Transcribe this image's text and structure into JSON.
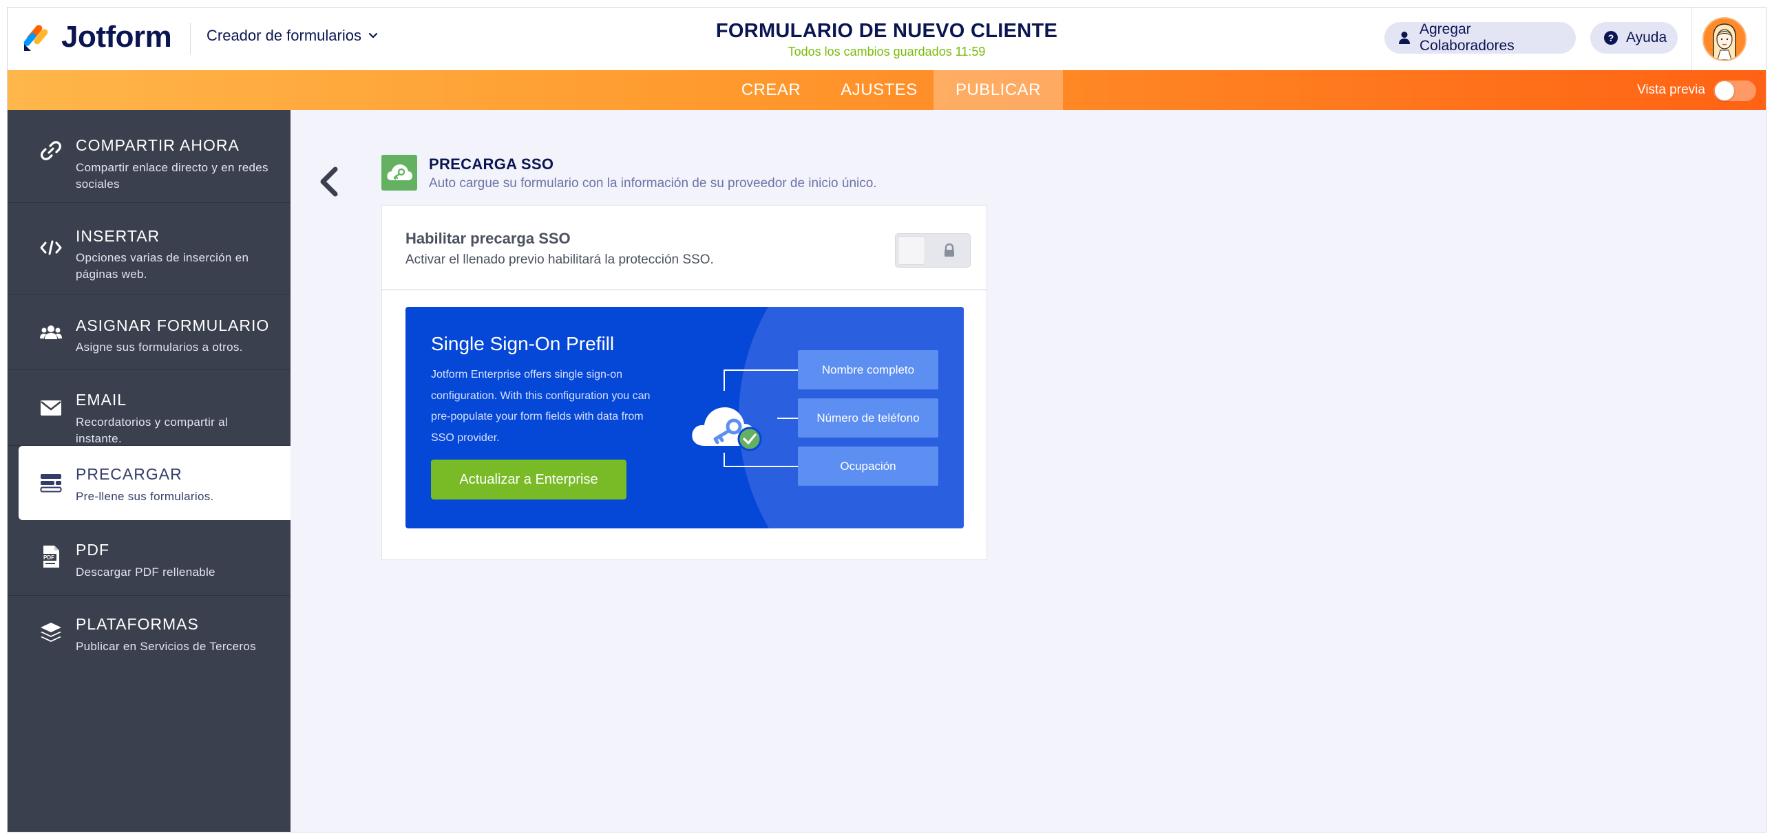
{
  "header": {
    "logo_text": "Jotform",
    "builder_label": "Creador de formularios",
    "form_title": "FORMULARIO DE NUEVO CLIENTE",
    "save_status": "Todos los cambios guardados 11:59",
    "collaborators_label": "Agregar Colaboradores",
    "help_label": "Ayuda"
  },
  "nav": {
    "tabs": [
      {
        "label": "CREAR"
      },
      {
        "label": "AJUSTES"
      },
      {
        "label": "PUBLICAR",
        "active": true
      }
    ],
    "preview_label": "Vista previa"
  },
  "sidebar": {
    "items": [
      {
        "title": "COMPARTIR AHORA",
        "desc": "Compartir enlace directo y en redes sociales",
        "icon": "link-icon"
      },
      {
        "title": "INSERTAR",
        "desc": "Opciones varias de inserción en páginas web.",
        "icon": "code-icon"
      },
      {
        "title": "ASIGNAR FORMULARIO",
        "desc": "Asigne sus formularios a otros.",
        "icon": "users-icon"
      },
      {
        "title": "EMAIL",
        "desc": "Recordatorios y compartir al instante.",
        "icon": "envelope-icon"
      },
      {
        "title": "PRECARGAR",
        "desc": "Pre-llene sus formularios.",
        "icon": "prefill-icon",
        "active": true
      },
      {
        "title": "PDF",
        "desc": "Descargar PDF rellenable",
        "icon": "pdf-icon"
      },
      {
        "title": "PLATAFORMAS",
        "desc": "Publicar en Servicios de Terceros",
        "icon": "layers-icon"
      }
    ]
  },
  "main": {
    "section_title": "PRECARGA SSO",
    "section_subtitle": "Auto cargue su formulario con la información de su proveedor de inicio único.",
    "enable_title": "Habilitar precarga SSO",
    "enable_desc": "Activar el llenado previo habilitará la protección SSO.",
    "promo": {
      "title": "Single Sign-On Prefill",
      "text": "Jotform Enterprise offers single sign-on configuration. With this configuration you can pre-populate your form fields with data from SSO provider.",
      "button_label": "Actualizar a Enterprise",
      "fields": [
        "Nombre completo",
        "Número de teléfono",
        "Ocupación"
      ]
    }
  },
  "colors": {
    "brand_navy": "#0a1551",
    "accent_orange": "#ff7a1e",
    "saved_green": "#78bb07",
    "sidebar_bg": "#3b404e",
    "promo_blue": "#0547d6",
    "upgrade_green": "#78bb26"
  }
}
